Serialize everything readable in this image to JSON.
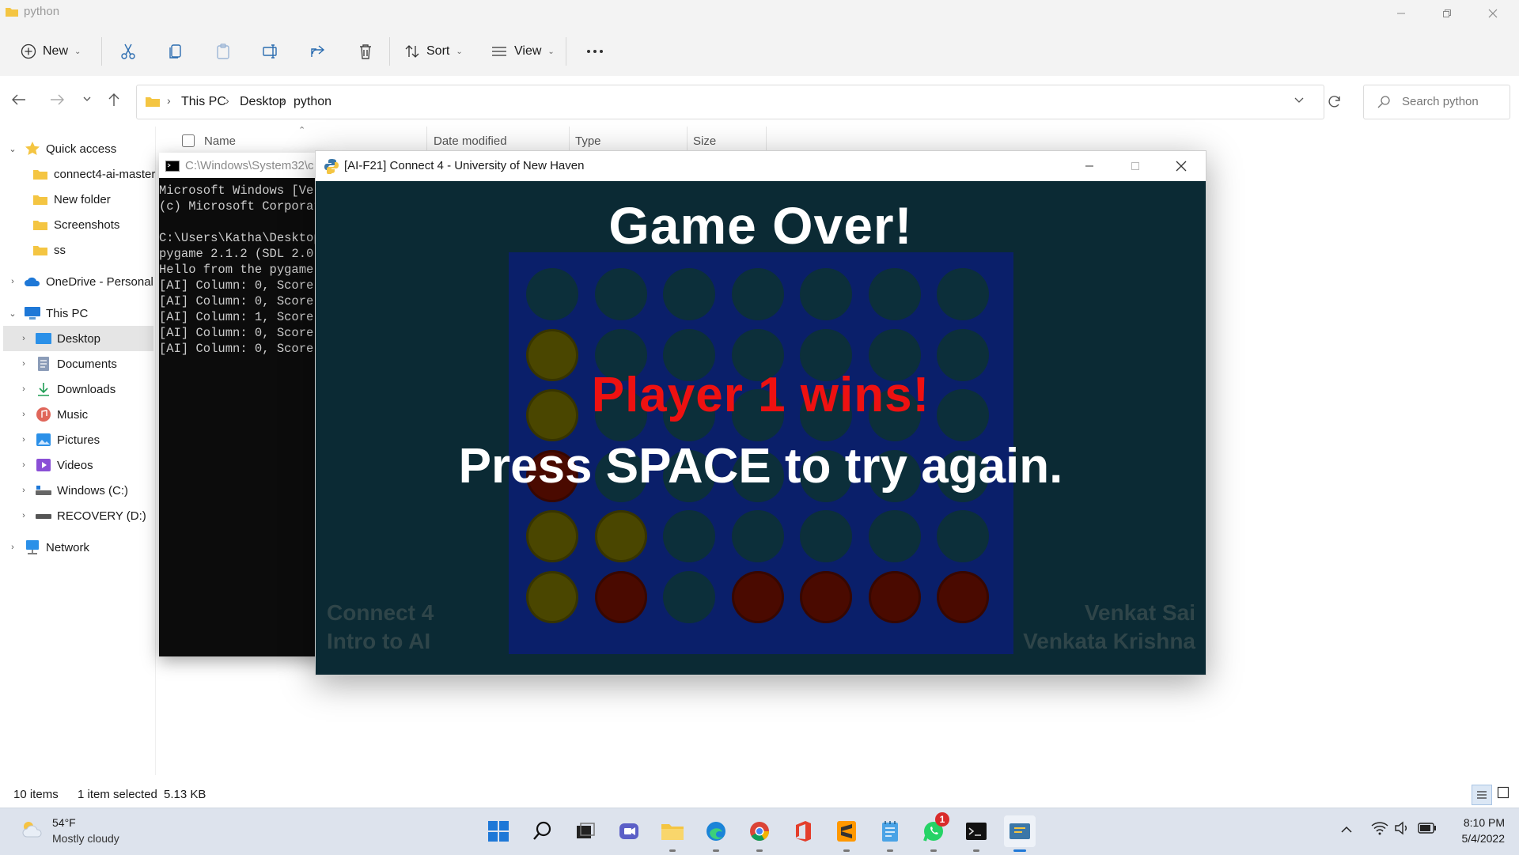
{
  "window": {
    "title": "python"
  },
  "toolbar": {
    "new_label": "New",
    "sort_label": "Sort",
    "view_label": "View"
  },
  "address": {
    "crumbs": [
      "This PC",
      "Desktop",
      "python"
    ],
    "search_placeholder": "Search python"
  },
  "nav": {
    "items": [
      {
        "label": "Quick access"
      },
      {
        "label": "connect4-ai-master"
      },
      {
        "label": "New folder"
      },
      {
        "label": "Screenshots"
      },
      {
        "label": "ss"
      },
      {
        "label": "OneDrive - Personal"
      },
      {
        "label": "This PC"
      },
      {
        "label": "Desktop"
      },
      {
        "label": "Documents"
      },
      {
        "label": "Downloads"
      },
      {
        "label": "Music"
      },
      {
        "label": "Pictures"
      },
      {
        "label": "Videos"
      },
      {
        "label": "Windows (C:)"
      },
      {
        "label": "RECOVERY (D:)"
      },
      {
        "label": "Network"
      }
    ]
  },
  "columns": [
    "Name",
    "Date modified",
    "Type",
    "Size"
  ],
  "status": {
    "items": "10 items",
    "selected": "1 item selected",
    "size": "5.13 KB"
  },
  "console": {
    "title": "C:\\Windows\\System32\\c",
    "lines": [
      "Microsoft Windows [Ver",
      "(c) Microsoft Corporat",
      "",
      "C:\\Users\\Katha\\Desktop",
      "pygame 2.1.2 (SDL 2.0.",
      "Hello from the pygame ",
      "[AI] Column: 0, Score:",
      "[AI] Column: 0, Score:",
      "[AI] Column: 1, Score:",
      "[AI] Column: 0, Score:",
      "[AI] Column: 0, Score:"
    ]
  },
  "game": {
    "window_title": "[AI-F21] Connect 4 - University of New Haven",
    "heading": "Game Over!",
    "winner": "Player 1 wins!",
    "retry": "Press SPACE to try again.",
    "credit_left": [
      "Connect 4",
      "Intro to AI"
    ],
    "credit_right": [
      "Venkat Sai",
      "Venkata Krishna"
    ],
    "board": [
      [
        "E",
        "E",
        "E",
        "E",
        "E",
        "E",
        "E"
      ],
      [
        "Y",
        "E",
        "E",
        "E",
        "E",
        "E",
        "E"
      ],
      [
        "Y",
        "E",
        "E",
        "E",
        "E",
        "E",
        "E"
      ],
      [
        "R",
        "E",
        "E",
        "E",
        "E",
        "E",
        "E"
      ],
      [
        "Y",
        "Y",
        "E",
        "E",
        "E",
        "E",
        "E"
      ],
      [
        "Y",
        "R",
        "E",
        "R",
        "R",
        "R",
        "R"
      ]
    ],
    "colors": {
      "bg": "#0b2a34",
      "board": "#0a1f6a",
      "empty": "#0c2f3a",
      "yellow": "#4a4600",
      "red": "#4a0a00",
      "win_text": "#ee1111"
    }
  },
  "taskbar": {
    "weather_temp": "54°F",
    "weather_desc": "Mostly cloudy",
    "time": "8:10 PM",
    "date": "5/4/2022",
    "whatsapp_badge": "1",
    "apps": [
      "start-icon",
      "search-icon",
      "task-view-icon",
      "chat-icon",
      "file-explorer-icon",
      "edge-icon",
      "chrome-icon",
      "office-icon",
      "sublime-icon",
      "notepad-icon",
      "whatsapp-icon",
      "terminal-icon",
      "python-icon"
    ]
  }
}
